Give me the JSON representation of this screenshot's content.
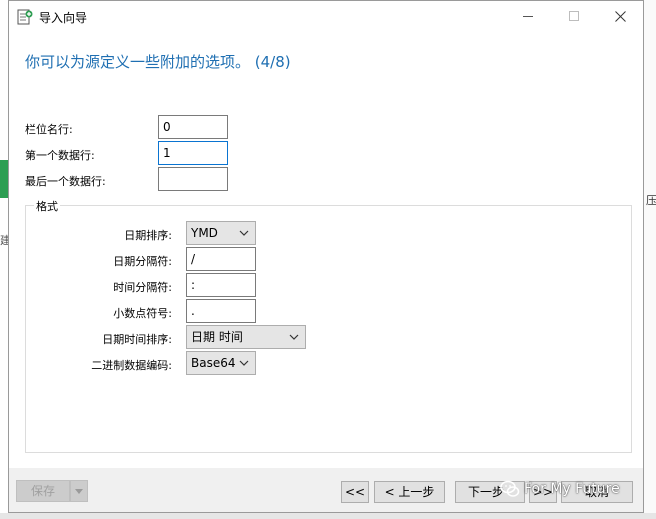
{
  "window": {
    "title": "导入向导",
    "icon": "import-wizard-icon"
  },
  "heading": "你可以为源定义一些附加的选项。 (4/8)",
  "fields": {
    "field_name_row": {
      "label": "栏位名行:",
      "value": "0"
    },
    "first_data_row": {
      "label": "第一个数据行:",
      "value": "1"
    },
    "last_data_row": {
      "label": "最后一个数据行:",
      "value": ""
    }
  },
  "format_group": {
    "title": "格式",
    "date_order": {
      "label": "日期排序:",
      "value": "YMD"
    },
    "date_delimiter": {
      "label": "日期分隔符:",
      "value": "/"
    },
    "time_delimiter": {
      "label": "时间分隔符:",
      "value": ":"
    },
    "decimal_symbol": {
      "label": "小数点符号:",
      "value": "."
    },
    "datetime_order": {
      "label": "日期时间排序:",
      "value": "日期 时间"
    },
    "binary_encoding": {
      "label": "二进制数据编码:",
      "value": "Base64"
    }
  },
  "buttons": {
    "save": "保存",
    "first": "<<",
    "back": "< 上一步",
    "next": "下一步",
    "last": ">>",
    "cancel": "取消"
  },
  "watermark": "For My Future",
  "background": {
    "right_glyph": "压",
    "left_glyph": "建"
  },
  "colors": {
    "heading": "#1f6fb2",
    "focus_border": "#0a74d1",
    "accent_green": "#2e9e53"
  }
}
